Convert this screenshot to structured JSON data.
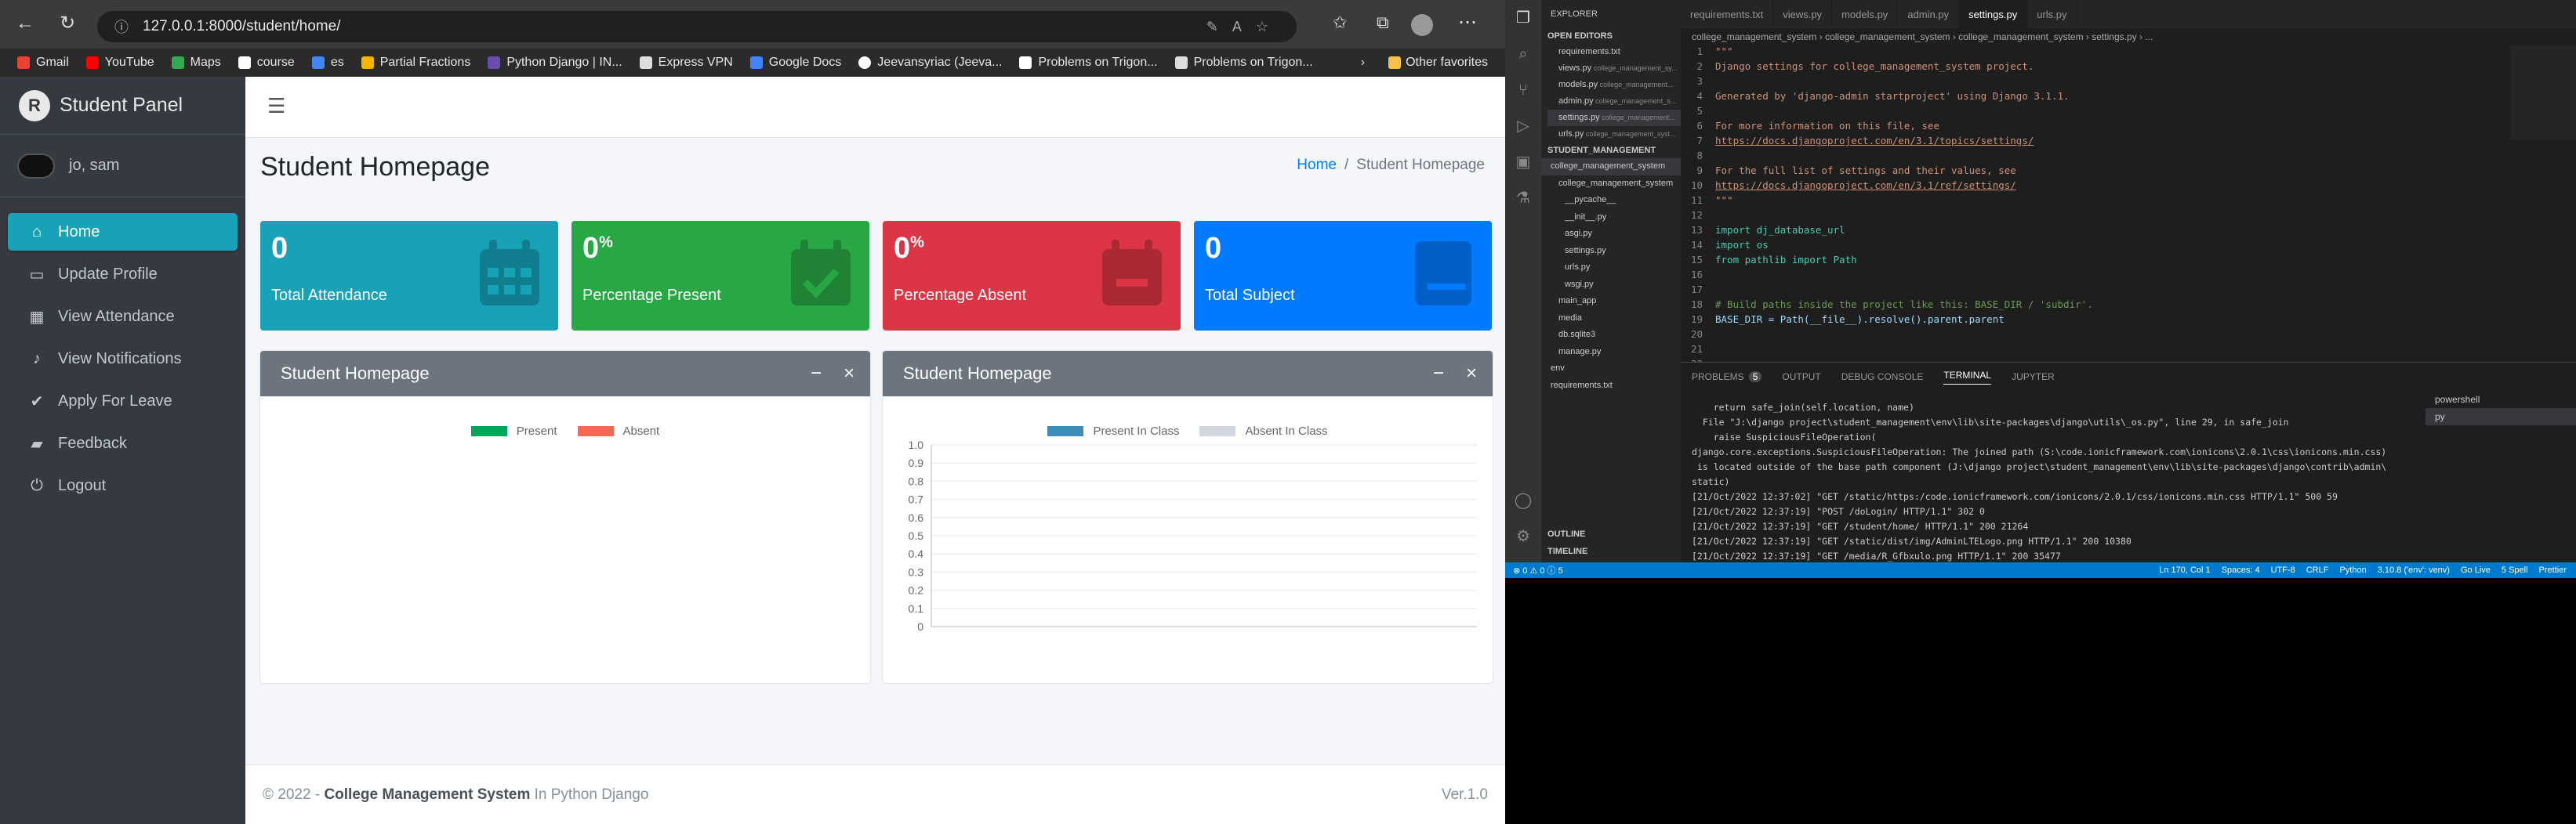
{
  "browser": {
    "url": "127.0.0.1:8000/student/home/",
    "bookmarks": [
      "Gmail",
      "YouTube",
      "Maps",
      "course",
      "es",
      "Partial Fractions",
      "Python Django | IN...",
      "Express VPN",
      "Google Docs",
      "Jeevansyriac (Jeeva...",
      "Problems on Trigon...",
      "Problems on Trigon..."
    ],
    "other_favorites": "Other favorites"
  },
  "app": {
    "brand": "Student Panel",
    "user": "jo, sam",
    "nav": [
      "Home",
      "Update Profile",
      "View Attendance",
      "View Notifications",
      "Apply For Leave",
      "Feedback",
      "Logout"
    ],
    "page_title": "Student Homepage",
    "breadcrumb_home": "Home",
    "breadcrumb_sep": "/",
    "breadcrumb_current": "Student Homepage",
    "stats": [
      {
        "value": "0",
        "unit": "",
        "label": "Total Attendance",
        "color": "#17a2b8"
      },
      {
        "value": "0",
        "unit": "%",
        "label": "Percentage Present",
        "color": "#28a745"
      },
      {
        "value": "0",
        "unit": "%",
        "label": "Percentage Absent",
        "color": "#dc3545"
      },
      {
        "value": "0",
        "unit": "",
        "label": "Total Subject",
        "color": "#007bff"
      }
    ],
    "card1_title": "Student Homepage",
    "card2_title": "Student Homepage",
    "tool_min": "−",
    "tool_close": "×",
    "footer_prefix": "© 2022 - ",
    "footer_bold": "College Management System",
    "footer_suffix": " In Python Django",
    "footer_version": "Ver.1.0"
  },
  "chart_data": [
    {
      "type": "pie",
      "series": [
        {
          "name": "Present",
          "color": "#00a65a",
          "values": []
        },
        {
          "name": "Absent",
          "color": "#f56954",
          "values": []
        }
      ]
    },
    {
      "type": "bar",
      "series": [
        {
          "name": "Present In Class",
          "color": "#3c8dbc",
          "values": []
        },
        {
          "name": "Absent In Class",
          "color": "#d2d6de",
          "values": []
        }
      ],
      "ylim": [
        0,
        1
      ],
      "yticks": [
        "1.0",
        "0.9",
        "0.8",
        "0.7",
        "0.6",
        "0.5",
        "0.4",
        "0.3",
        "0.2",
        "0.1",
        "0"
      ]
    }
  ],
  "vscode": {
    "explorer_label": "EXPLORER",
    "open_editors_label": "OPEN EDITORS",
    "open_editors": [
      "requirements.txt",
      "views.py",
      "models.py",
      "admin.py",
      "settings.py",
      "urls.py"
    ],
    "open_editors_paths": [
      "",
      "college_management_sy...",
      "college_management...",
      "college_management_s...",
      "college_management...",
      "college_management_syst..."
    ],
    "project_label": "STUDENT_MANAGEMENT",
    "tree": [
      "college_management_system",
      "college_management_system",
      "__pycache__",
      "__init__.py",
      "asgi.py",
      "settings.py",
      "urls.py",
      "wsgi.py",
      "main_app",
      "media",
      "db.sqlite3",
      "manage.py",
      "env",
      "requirements.txt"
    ],
    "outline": "OUTLINE",
    "timeline": "TIMELINE",
    "tabs": [
      "requirements.txt",
      "views.py",
      "models.py",
      "admin.py",
      "settings.py",
      "urls.py"
    ],
    "breadcrumb": "college_management_system › college_management_system › college_management_system › settings.py › ...",
    "code": [
      "\"\"\"",
      "Django settings for college_management_system project.",
      "",
      "Generated by 'django-admin startproject' using Django 3.1.1.",
      "",
      "For more information on this file, see",
      "https://docs.djangoproject.com/en/3.1/topics/settings/",
      "",
      "For the full list of settings and their values, see",
      "https://docs.djangoproject.com/en/3.1/ref/settings/",
      "\"\"\"",
      "",
      "import dj_database_url",
      "import os",
      "from pathlib import Path",
      "",
      "",
      "# Build paths inside the project like this: BASE_DIR / 'subdir'.",
      "BASE_DIR = Path(__file__).resolve().parent.parent",
      "",
      "",
      ""
    ],
    "panel_tabs": [
      "PROBLEMS",
      "OUTPUT",
      "DEBUG CONSOLE",
      "TERMINAL",
      "JUPYTER"
    ],
    "problems_count": "5",
    "terminals": [
      "powershell",
      "py"
    ],
    "terminal": [
      "    return safe_join(self.location, name)",
      "  File \"J:\\django project\\student_management\\env\\lib\\site-packages\\django\\utils\\_os.py\", line 29, in safe_join",
      "    raise SuspiciousFileOperation(",
      "django.core.exceptions.SuspiciousFileOperation: The joined path (S:\\code.ionicframework.com\\ionicons\\2.0.1\\css\\ionicons.min.css)",
      " is located outside of the base path component (J:\\django project\\student_management\\env\\lib\\site-packages\\django\\contrib\\admin\\",
      "static)",
      "[21/Oct/2022 12:37:02] \"GET /static/https:/code.ionicframework.com/ionicons/2.0.1/css/ionicons.min.css HTTP/1.1\" 500 59",
      "[21/Oct/2022 12:37:19] \"POST /doLogin/ HTTP/1.1\" 302 0",
      "[21/Oct/2022 12:37:19] \"GET /student/home/ HTTP/1.1\" 200 21264",
      "[21/Oct/2022 12:37:19] \"GET /static/dist/img/AdminLTELogo.png HTTP/1.1\" 200 10380",
      "[21/Oct/2022 12:37:19] \"GET /media/R_Gfbxulo.png HTTP/1.1\" 200 35477"
    ],
    "status_left": "⊗ 0  ⚠ 0  ⓘ 5",
    "status_right": [
      "Ln 170, Col 1",
      "Spaces: 4",
      "UTF-8",
      "CRLF",
      "Python",
      "3.10.8 ('env': venv)",
      "Go Live",
      "5 Spell",
      "Prettier"
    ]
  }
}
